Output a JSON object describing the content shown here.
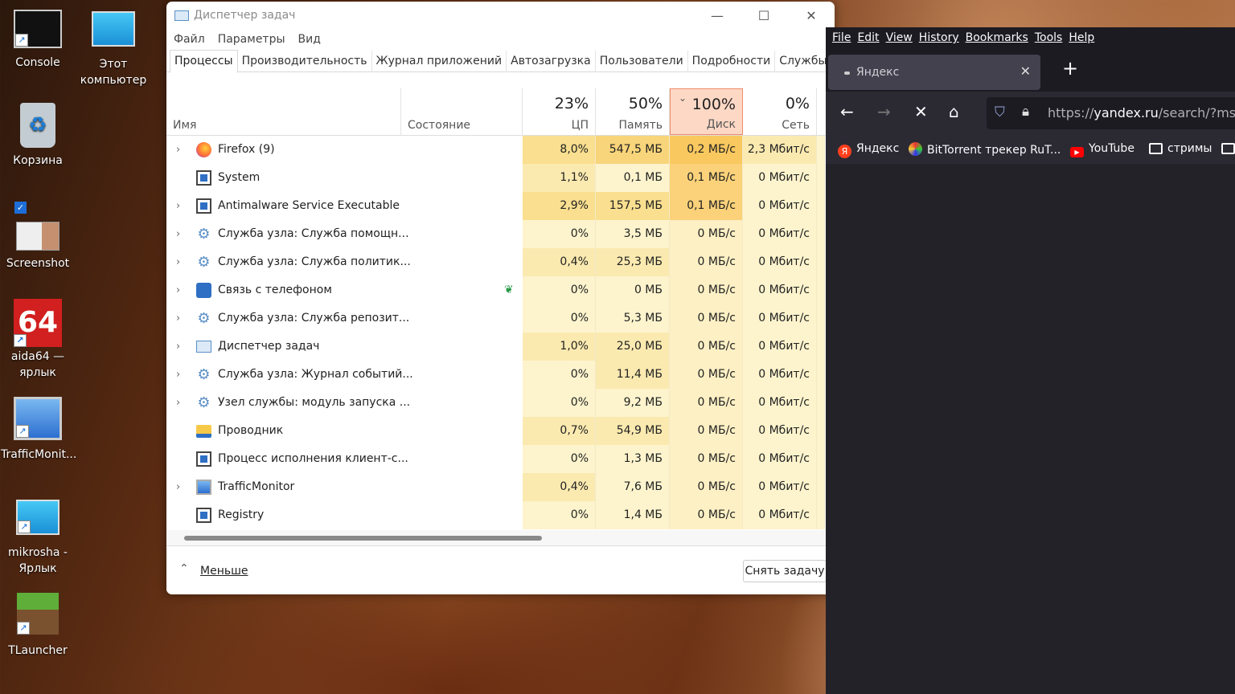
{
  "desktop": {
    "icons": [
      {
        "label": "Console"
      },
      {
        "label": "Этот компьютер"
      },
      {
        "label": "Корзина"
      },
      {
        "label": "Screenshot"
      },
      {
        "label": "aida64 — ярлык"
      },
      {
        "label": "TrafficMonit..."
      },
      {
        "label": "mikrosha - Ярлык"
      },
      {
        "label": "TLauncher"
      }
    ]
  },
  "taskmanager": {
    "title": "Диспетчер задач",
    "menu": [
      "Файл",
      "Параметры",
      "Вид"
    ],
    "tabs": [
      "Процессы",
      "Производительность",
      "Журнал приложений",
      "Автозагрузка",
      "Пользователи",
      "Подробности",
      "Службы"
    ],
    "columns": {
      "name": "Имя",
      "status": "Состояние",
      "cpu": {
        "pct": "23%",
        "label": "ЦП"
      },
      "mem": {
        "pct": "50%",
        "label": "Память"
      },
      "disk": {
        "pct": "100%",
        "label": "Диск"
      },
      "net": {
        "pct": "0%",
        "label": "Сеть"
      }
    },
    "rows": [
      {
        "name": "Firefox (9)",
        "cpu": "8,0%",
        "mem": "547,5 МБ",
        "disk": "0,2 МБ/с",
        "net": "2,3 Мбит/с"
      },
      {
        "name": "System",
        "cpu": "1,1%",
        "mem": "0,1 МБ",
        "disk": "0,1 МБ/с",
        "net": "0 Мбит/с"
      },
      {
        "name": "Antimalware Service Executable",
        "cpu": "2,9%",
        "mem": "157,5 МБ",
        "disk": "0,1 МБ/с",
        "net": "0 Мбит/с"
      },
      {
        "name": "Служба узла: Служба помощн...",
        "cpu": "0%",
        "mem": "3,5 МБ",
        "disk": "0 МБ/с",
        "net": "0 Мбит/с"
      },
      {
        "name": "Служба узла: Служба политик...",
        "cpu": "0,4%",
        "mem": "25,3 МБ",
        "disk": "0 МБ/с",
        "net": "0 Мбит/с"
      },
      {
        "name": "Связь с телефоном",
        "cpu": "0%",
        "mem": "0 МБ",
        "disk": "0 МБ/с",
        "net": "0 Мбит/с"
      },
      {
        "name": "Служба узла: Служба репозит...",
        "cpu": "0%",
        "mem": "5,3 МБ",
        "disk": "0 МБ/с",
        "net": "0 Мбит/с"
      },
      {
        "name": "Диспетчер задач",
        "cpu": "1,0%",
        "mem": "25,0 МБ",
        "disk": "0 МБ/с",
        "net": "0 Мбит/с"
      },
      {
        "name": "Служба узла: Журнал событий...",
        "cpu": "0%",
        "mem": "11,4 МБ",
        "disk": "0 МБ/с",
        "net": "0 Мбит/с"
      },
      {
        "name": "Узел службы: модуль запуска ...",
        "cpu": "0%",
        "mem": "9,2 МБ",
        "disk": "0 МБ/с",
        "net": "0 Мбит/с"
      },
      {
        "name": "Проводник",
        "cpu": "0,7%",
        "mem": "54,9 МБ",
        "disk": "0 МБ/с",
        "net": "0 Мбит/с"
      },
      {
        "name": "Процесс исполнения клиент-с...",
        "cpu": "0%",
        "mem": "1,3 МБ",
        "disk": "0 МБ/с",
        "net": "0 Мбит/с"
      },
      {
        "name": "TrafficMonitor",
        "cpu": "0,4%",
        "mem": "7,6 МБ",
        "disk": "0 МБ/с",
        "net": "0 Мбит/с"
      },
      {
        "name": "Registry",
        "cpu": "0%",
        "mem": "1,4 МБ",
        "disk": "0 МБ/с",
        "net": "0 Мбит/с"
      }
    ],
    "footer": {
      "less": "Меньше",
      "end_task": "Снять задачу"
    }
  },
  "firefox": {
    "menu": [
      "File",
      "Edit",
      "View",
      "History",
      "Bookmarks",
      "Tools",
      "Help"
    ],
    "tab_title": "Яндекс",
    "url_prefix": "https://",
    "url_host": "yandex.ru",
    "url_path": "/search/?msid",
    "bookmarks": [
      "Яндекс",
      "BitTorrent трекер RuT...",
      "YouTube",
      "стримы"
    ]
  }
}
